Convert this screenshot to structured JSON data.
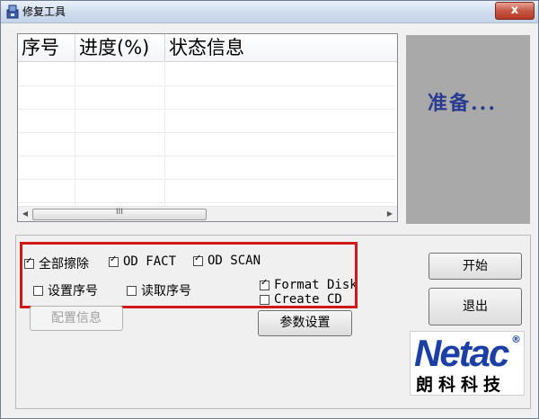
{
  "window": {
    "title": "修复工具",
    "close_glyph": "x"
  },
  "list": {
    "columns": [
      "序号",
      "进度(%)",
      "状态信息"
    ],
    "rows": [],
    "scroll_grip": "III"
  },
  "status": {
    "text": "准备..."
  },
  "options": {
    "full_erase": {
      "label": "全部擦除",
      "checked": true
    },
    "od_fact": {
      "label": "OD FACT",
      "checked": true
    },
    "od_scan": {
      "label": "OD SCAN",
      "checked": true
    },
    "set_serial": {
      "label": "设置序号",
      "checked": false
    },
    "read_serial": {
      "label": "读取序号",
      "checked": false
    },
    "format_disk": {
      "label": "Format Disk",
      "checked": true
    },
    "create_cd": {
      "label": "Create CD",
      "checked": false
    }
  },
  "buttons": {
    "config_info": "配置信息",
    "param_settings": "参数设置",
    "start": "开始",
    "exit": "退出"
  },
  "logo": {
    "word": "Netac",
    "reg": "®",
    "chinese": "朗科科技"
  },
  "icons": [
    "app-icon",
    "close-icon",
    "scroll-left-icon",
    "scroll-right-icon",
    "checkbox-icon"
  ],
  "colors": {
    "status_text": "#283b8f",
    "highlight_border": "#d01818",
    "logo_blue": "#1b3fa5",
    "close_button": "#c75846"
  }
}
